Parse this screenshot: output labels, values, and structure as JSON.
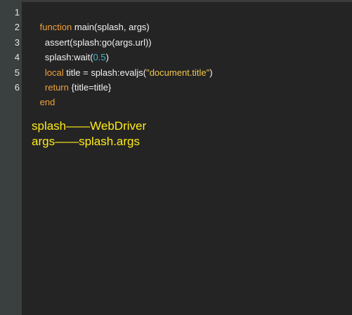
{
  "editor": {
    "line_numbers": [
      "1",
      "2",
      "3",
      "4",
      "5",
      "6"
    ],
    "lines": [
      [
        {
          "t": "function",
          "c": "kw"
        },
        {
          "t": " main(splash, args)",
          "c": "plain"
        }
      ],
      [
        {
          "t": "  assert(splash:go(args.url))",
          "c": "plain"
        }
      ],
      [
        {
          "t": "  splash:wait(",
          "c": "plain"
        },
        {
          "t": "0.5",
          "c": "num"
        },
        {
          "t": ")",
          "c": "plain"
        }
      ],
      [
        {
          "t": "  ",
          "c": "plain"
        },
        {
          "t": "local",
          "c": "kw"
        },
        {
          "t": " title = splash:evaljs(",
          "c": "plain"
        },
        {
          "t": "\"document.title\"",
          "c": "str"
        },
        {
          "t": ")",
          "c": "plain"
        }
      ],
      [
        {
          "t": "  ",
          "c": "plain"
        },
        {
          "t": "return",
          "c": "kw"
        },
        {
          "t": " {title=title}",
          "c": "plain"
        }
      ],
      [
        {
          "t": "end",
          "c": "kw"
        }
      ]
    ]
  },
  "notes": [
    "splash——WebDriver",
    "args——splash.args"
  ],
  "colors": {
    "background": "#242424",
    "gutter": "#3a3f3f",
    "keyword": "#f1a13a",
    "string": "#f1c84a",
    "number": "#3fb7c7",
    "text": "#f2f2f2",
    "annotation": "#ffeb1a"
  }
}
